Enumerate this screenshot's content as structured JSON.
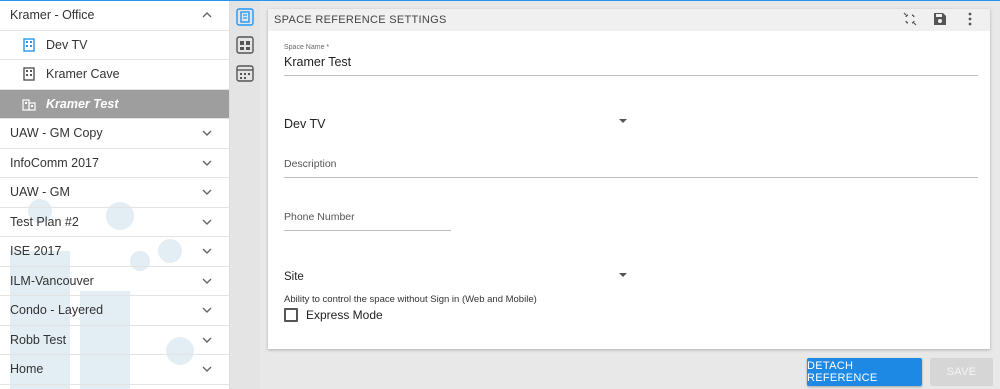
{
  "sidebar": {
    "groups_top": {
      "label": "Kramer - Office",
      "children": [
        {
          "label": "Dev TV",
          "icon": "building-icon"
        },
        {
          "label": "Kramer Cave",
          "icon": "building-icon"
        },
        {
          "label": "Kramer Test",
          "icon": "building-icon",
          "active": true
        }
      ]
    },
    "items": [
      {
        "label": "UAW - GM Copy"
      },
      {
        "label": "InfoComm 2017"
      },
      {
        "label": "UAW - GM"
      },
      {
        "label": "Test Plan #2"
      },
      {
        "label": "ISE 2017"
      },
      {
        "label": "ILM-Vancouver"
      },
      {
        "label": "Condo - Layered"
      },
      {
        "label": "Robb Test"
      },
      {
        "label": "Home"
      }
    ]
  },
  "panel": {
    "title": "SPACE REFERENCE SETTINGS",
    "space_name_label": "Space Name *",
    "space_name_value": "Kramer Test",
    "building_value": "Dev TV",
    "description_placeholder": "Description",
    "phone_placeholder": "Phone Number",
    "site_value": "Site",
    "ability_text": "Ability to control the space without Sign in (Web and Mobile)",
    "express_mode_label": "Express Mode"
  },
  "buttons": {
    "detach": "DETACH REFERENCE",
    "save": "SAVE"
  },
  "colors": {
    "accent": "#1e88e5",
    "active_item": "#9e9e9e"
  }
}
